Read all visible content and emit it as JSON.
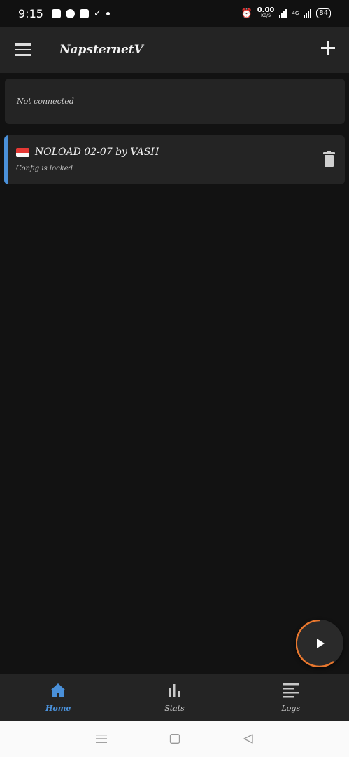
{
  "status_bar": {
    "time": "9:15",
    "net_speed_value": "0.00",
    "net_speed_unit": "KB/S",
    "network_label": "4G",
    "battery": "84"
  },
  "app_bar": {
    "title": "NapsternetV"
  },
  "connection": {
    "status": "Not connected"
  },
  "configs": [
    {
      "name": "NOLOAD 02-07 by VASH",
      "subtitle": "Config is locked",
      "flag": "indonesia-flag",
      "accent": "#4a90d9"
    }
  ],
  "bottom_nav": {
    "items": [
      {
        "label": "Home",
        "icon": "home-icon",
        "active": true
      },
      {
        "label": "Stats",
        "icon": "stats-icon",
        "active": false
      },
      {
        "label": "Logs",
        "icon": "logs-icon",
        "active": false
      }
    ]
  },
  "colors": {
    "accent": "#4a90d9",
    "fab_ring": "#e8772e",
    "surface": "#242424",
    "background": "#121212"
  }
}
